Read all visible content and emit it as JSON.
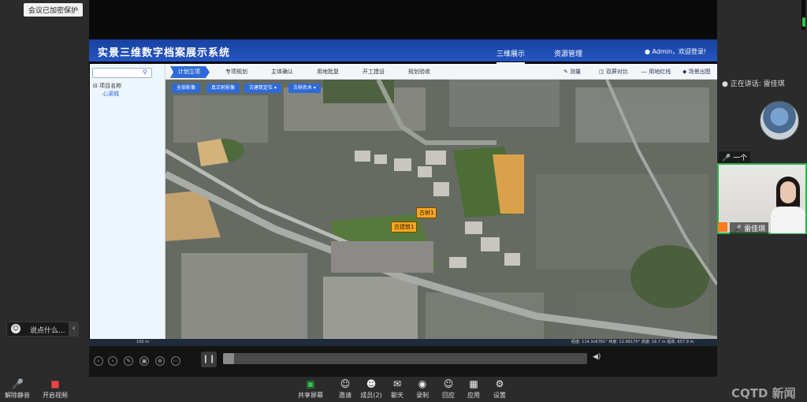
{
  "meeting": {
    "encryption_badge": "会议已加密保护",
    "speaking_prefix": "正在讲话:",
    "speaking_name": "雷佳琪",
    "participant_tag_1": "一个",
    "participant_name_2": "雷佳琪"
  },
  "app": {
    "title": "实景三维数字档案展示系统",
    "tabs": [
      "三维展示",
      "资源管理"
    ],
    "active_tab": "三维展示",
    "user": "Admin，欢迎登录!",
    "subtabs": [
      "计划立项",
      "专项规划",
      "主体确认",
      "用地批复",
      "开工建设",
      "规划验收"
    ],
    "tools": [
      "测量",
      "双屏对比",
      "用地红线",
      "场景出图"
    ],
    "sidebar": {
      "search_placeholder": "",
      "root": "项目名称",
      "child": "心湖城"
    },
    "map_buttons": [
      "全部影像",
      "真正射影像",
      "古建筑定位",
      "古树名木"
    ],
    "markers": [
      "古树1",
      "古建筑1"
    ],
    "status": {
      "left": "100 m",
      "coords": "经度: 114.3x6781°  纬度: 22.6817X°  高度: 16.7 m  视高: 657.9 m"
    }
  },
  "chat": {
    "placeholder": "说点什么..."
  },
  "toolbar": {
    "left": [
      "解除静音",
      "开启视频"
    ],
    "center": [
      "共享屏幕",
      "邀请",
      "成员(2)",
      "聊天",
      "录制",
      "回应",
      "应用",
      "设置"
    ]
  },
  "watermark": "CQTD 新闻",
  "colors": {
    "app_header": "#1f4fb5",
    "accent": "#2f6bd6",
    "marker": "#f5a623",
    "active_speaker_border": "#2bb34a"
  }
}
